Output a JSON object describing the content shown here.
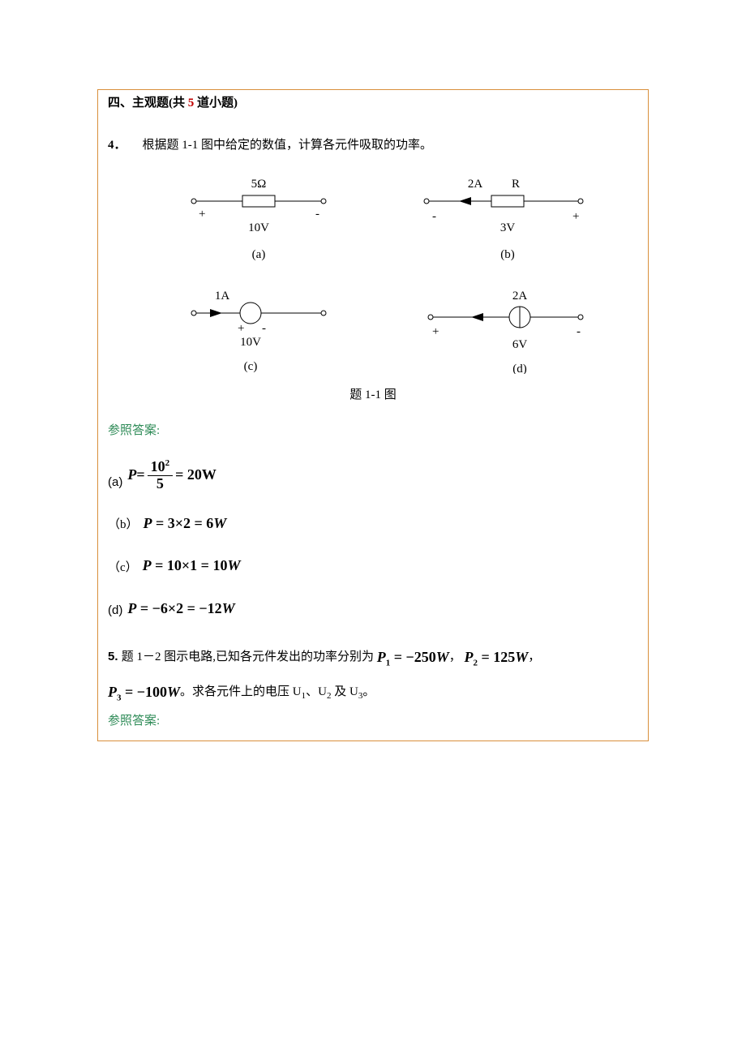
{
  "section": {
    "prefix": "四、主观题(共 ",
    "count": "5",
    "suffix": " 道小题)"
  },
  "q4": {
    "number": "4．",
    "text": "根据题 1-1 图中给定的数值，计算各元件吸取的功率。",
    "caption": "题 1-1 图",
    "diagrams": {
      "a": {
        "top": "5Ω",
        "plus": "+",
        "minus": "-",
        "val": "10V",
        "label": "(a)"
      },
      "b": {
        "cur": "2A",
        "r": "R",
        "plus": "+",
        "minus": "-",
        "val": "3V",
        "label": "(b)"
      },
      "c": {
        "cur": "1A",
        "plus": "+",
        "minus": "-",
        "val": "10V",
        "label": "(c)"
      },
      "d": {
        "cur": "2A",
        "plus": "+",
        "minus": "-",
        "val": "6V",
        "label": "(d)"
      }
    },
    "answer_label": "参照答案:",
    "answers": {
      "a": {
        "label": "(a)",
        "lhs": "P",
        "eq": "=",
        "num": "10",
        "exp": "2",
        "den": "5",
        "rhs": "= 20W"
      },
      "b": {
        "label": "（b）",
        "expr": "P = 3×2 = 6W"
      },
      "c": {
        "label": "（c）",
        "expr": "P = 10×1 = 10W"
      },
      "d": {
        "label": "(d)",
        "expr": "P = −6×2 = −12W"
      }
    }
  },
  "q5": {
    "number": "5. ",
    "text_pre": "题 1－2 图示电路,已知各元件发出的功率分别为 ",
    "p1": "P₁ = −250W",
    "sep1": "，",
    "p2": "P₂ = 125W",
    "sep2": "，",
    "p3": "P₃ = −100W",
    "tail": "。求各元件上的电压 U₁、U₂ 及 U₃。",
    "answer_label": "参照答案:"
  }
}
